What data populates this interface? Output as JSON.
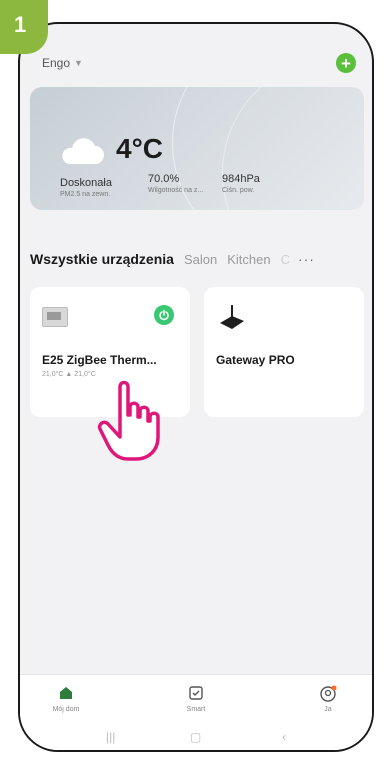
{
  "step": {
    "number": "1"
  },
  "header": {
    "home_name": "Engo",
    "add_label": "+"
  },
  "weather": {
    "temperature": "4°C",
    "stats": [
      {
        "value": "Doskonała",
        "label": "PM2.5 na zewn."
      },
      {
        "value": "70.0%",
        "label": "Wilgotność na z..."
      },
      {
        "value": "984hPa",
        "label": "Ciśn. pow."
      }
    ]
  },
  "tabs": [
    "Wszystkie urządzenia",
    "Salon",
    "Kitchen",
    "C"
  ],
  "more_label": "···",
  "devices": [
    {
      "name": "E25 ZigBee Therm...",
      "sub": "21,0°C  ▲ 21,0°C",
      "power_on": true
    },
    {
      "name": "Gateway PRO"
    }
  ],
  "bottom_nav": [
    {
      "label": "Mój dom",
      "icon": "home-icon",
      "active": true
    },
    {
      "label": "Smart",
      "icon": "smart-checkbox-icon"
    },
    {
      "label": "Ja",
      "icon": "profile-icon"
    }
  ],
  "colors": {
    "accent": "#5cbf3c",
    "badge": "#8cb83f",
    "power": "#37c871"
  }
}
